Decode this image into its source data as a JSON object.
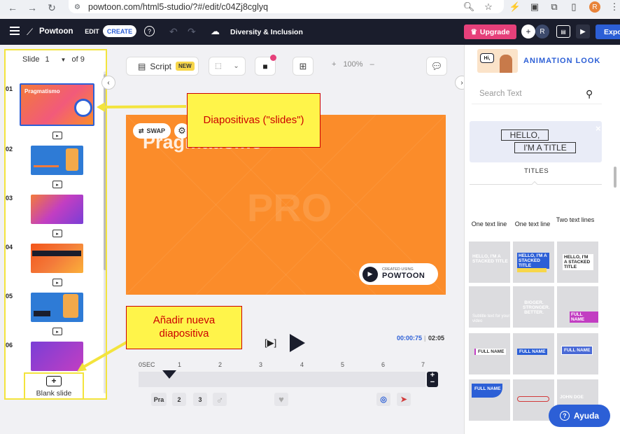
{
  "browser": {
    "url": "powtoon.com/html5-studio/?#/edit/c04Zj8cglyq",
    "profile_initial": "R"
  },
  "app": {
    "logo_text": "Powtoon",
    "mode_edit": "EDIT",
    "mode_create": "CREATE",
    "project_title": "Diversity & Inclusion",
    "upgrade_label": "Upgrade",
    "user_initial": "R",
    "export_label": "Expo"
  },
  "slides_panel": {
    "slide_label": "Slide",
    "current_slide": "1",
    "of_label": "of 9",
    "slides": [
      {
        "num": "01",
        "title": "Pragmatismo",
        "bg": "#fb8c2a"
      },
      {
        "num": "02",
        "title": "",
        "bg": "#2e7bd6"
      },
      {
        "num": "03",
        "title": "",
        "bg": "#9a3ed6"
      },
      {
        "num": "04",
        "title": "",
        "bg": "#fb8c2a"
      },
      {
        "num": "05",
        "title": "",
        "bg": "#2e7bd6"
      },
      {
        "num": "06",
        "title": "",
        "bg": "#9a3ed6"
      }
    ],
    "blank_slide_label": "Blank slide"
  },
  "toolbar": {
    "script_label": "Script",
    "new_badge": "NEW",
    "zoom_in": "+",
    "zoom_level": "100%",
    "zoom_out": "–"
  },
  "canvas": {
    "title": "Pragmatismo",
    "pro_watermark": "PRO",
    "swap_label": "SWAP",
    "watermark_small": "CREATED USING",
    "watermark_brand": "POWTOON"
  },
  "playback": {
    "frame_label": "[▶]",
    "time_current": "00:00:75",
    "time_separator": "|",
    "time_total": "02:05"
  },
  "timeline": {
    "labels": [
      "0SEC",
      "1",
      "2",
      "3",
      "4",
      "5",
      "6",
      "7"
    ],
    "items": [
      "Pra",
      "2",
      "3"
    ]
  },
  "right_panel": {
    "hi_text": "Hi,",
    "panel_title": "ANIMATION LOOK",
    "search_placeholder": "Search Text",
    "card_hello": "HELLO,",
    "card_title": "I'M A TITLE",
    "titles_label": "TITLES",
    "filters": [
      "One text line",
      "One text line",
      "Two text lines"
    ],
    "tiles": [
      {
        "text": "HELLO, I'M A STACKED TITLE",
        "bg": "#d8d8dc"
      },
      {
        "text": "HELLO, I'M A STACKED TITLE",
        "bg": "#d8d8dc"
      },
      {
        "text": "HELLO, I'M A STACKED TITLE",
        "bg": "#d8d8dc"
      },
      {
        "text": "Subtitle text for your video",
        "bg": "#d0d0d6"
      },
      {
        "text": "BIGGER. STRONGER. BETTER.",
        "bg": "#d8d8dc"
      },
      {
        "text": "FULL NAME",
        "bg": "#d8d8dc"
      },
      {
        "text": "FULL NAME",
        "bg": "#d8d8dc"
      },
      {
        "text": "FULL NAME",
        "bg": "#d8d8dc"
      },
      {
        "text": "FULL NAME",
        "bg": "#d8d8dc"
      },
      {
        "text": "FULL NAME",
        "bg": "#d8d8dc"
      },
      {
        "text": "",
        "bg": "#d8d8dc"
      },
      {
        "text": "JOHN DOE",
        "bg": "#d8d8dc"
      }
    ],
    "help_label": "Ayuda"
  },
  "annotations": {
    "slides_callout": "Diapositivas (\"slides\")",
    "add_callout": "Añadir nueva diapositiva"
  },
  "colors": {
    "accent": "#2c5fd6",
    "upgrade": "#e6407a",
    "canvas_bg": "#fb8c2a",
    "dark_bar": "#1a1d2c",
    "highlight": "#f3e43d"
  }
}
